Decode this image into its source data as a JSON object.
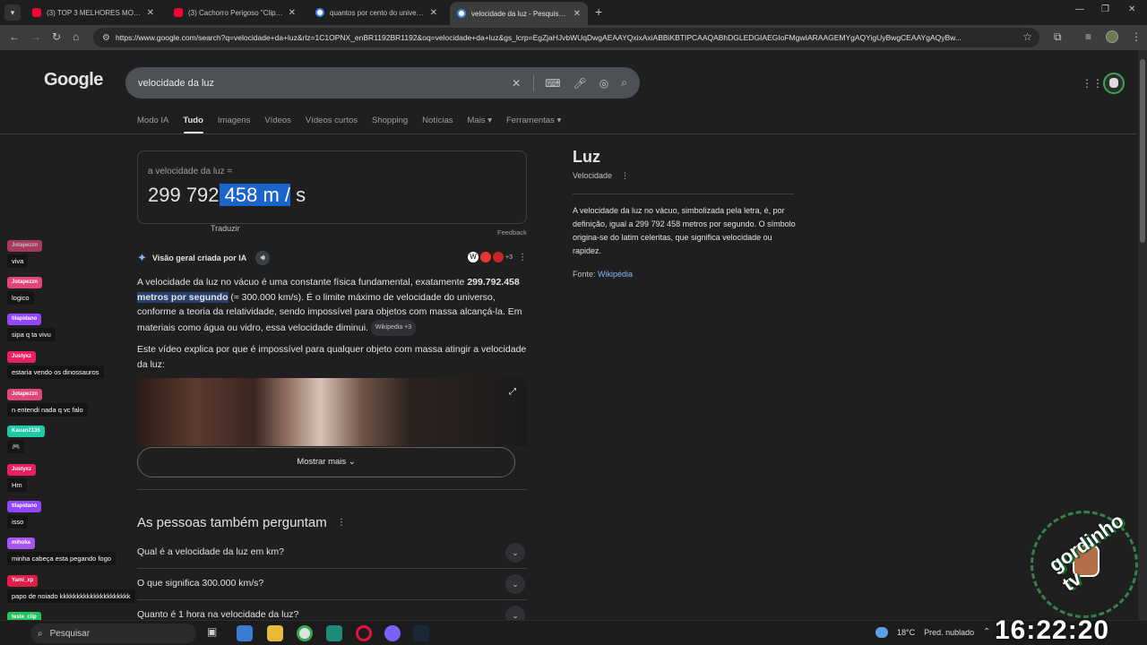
{
  "browser": {
    "tabs": [
      {
        "title": "(3) TOP 3 MELHORES MOUSES",
        "favicon": "youtube-icon"
      },
      {
        "title": "(3) Cachorro Perigoso \"Clipe Of",
        "favicon": "youtube-icon"
      },
      {
        "title": "quantos por cento do universo",
        "favicon": "google-icon"
      },
      {
        "title": "velocidade da luz - Pesquisa Go",
        "favicon": "google-icon"
      }
    ],
    "url": "https://www.google.com/search?q=velocidade+da+luz&rlz=1C1OPNX_enBR1192BR1192&oq=velocidade+da+luz&gs_lcrp=EgZjaHJvbWUqDwgAEAAYQxixAxiABBiKBTIPCAAQABhDGLEDGIAEGIoFMgwIARAAGEMYgAQYigUyBwgCEAAYgAQyBw..."
  },
  "google": {
    "logo": "Google",
    "query": "velocidade da luz",
    "tabs": [
      "Modo IA",
      "Tudo",
      "Imagens",
      "Vídeos",
      "Vídeos curtos",
      "Shopping",
      "Notícias",
      "Mais ▾",
      "Ferramentas ▾"
    ],
    "converter": {
      "label": "a velocidade da luz =",
      "value_plain": "299 792",
      "value_highlight": " 458 m /",
      "value_tail": " s",
      "translate": "Traduzir",
      "feedback": "Feedback"
    },
    "ai": {
      "heading": "Visão geral criada por IA",
      "sources_more": "+3",
      "p1_a": "A velocidade da luz no vácuo é uma constante física fundamental, exatamente ",
      "p1_b": "299.792.458",
      "p1_c": " metros por segundo",
      "p1_d": " (≈ 300.000 km/s). É o limite máximo de velocidade do universo, conforme a teoria da relatividade, sendo impossível para objetos com massa alcançá-la. Em materiais como água ou vidro, essa velocidade diminui.",
      "chip": "Wikipedia +3",
      "p2": "Este vídeo explica por que é impossível para qualquer objeto com massa atingir a velocidade da luz:",
      "show_more": "Mostrar mais"
    },
    "paa": {
      "title": "As pessoas também perguntam",
      "items": [
        "Qual é a velocidade da luz em km?",
        "O que significa 300.000 km/s?",
        "Quanto é 1 hora na velocidade da luz?"
      ]
    },
    "knowledge_panel": {
      "title": "Luz",
      "subtitle": "Velocidade",
      "description": "A velocidade da luz no vácuo, simbolizada pela letra, é, por definição, igual a 299 792 458 metros por segundo. O símbolo origina-se do latim celeritas, que significa velocidade ou rapidez.",
      "source_label": "Fonte:",
      "source_link": "Wikipédia"
    }
  },
  "chat": [
    {
      "user": "Jotapezzn",
      "color": "#e0457b",
      "msg": "viva"
    },
    {
      "user": "Jotapezzn",
      "color": "#e0457b",
      "msg": "logico"
    },
    {
      "user": "tilapidano",
      "color": "#9146ff",
      "msg": "sipa q ta vivu"
    },
    {
      "user": "Justyxz",
      "color": "#e91e63",
      "msg": "estaria vendo os dinossauros"
    },
    {
      "user": "Jotapezzn",
      "color": "#e0457b",
      "msg": "n entendi nada q vc falo"
    },
    {
      "user": "Kauan2135",
      "color": "#1fc9a6",
      "msg": "🎮"
    },
    {
      "user": "Justyxz",
      "color": "#e91e63",
      "msg": "Hm"
    },
    {
      "user": "tilapidano",
      "color": "#9146ff",
      "msg": "isso"
    },
    {
      "user": "mihoka",
      "color": "#a855f7",
      "msg": "minha cabeça esta pegando fogo"
    },
    {
      "user": "Yami_xp",
      "color": "#e11d48",
      "msg": "papo de noiado kkkkkkkkkkkkkkkkkkkkk"
    },
    {
      "user": "teste_clip",
      "color": "#22c55e",
      "msg": "rapaz"
    }
  ],
  "overlay": {
    "watermark": "gordinho tv"
  },
  "taskbar": {
    "search": "Pesquisar",
    "weather": "18°C",
    "forecast": "Pred. nublado",
    "clock": "16:22:20"
  }
}
